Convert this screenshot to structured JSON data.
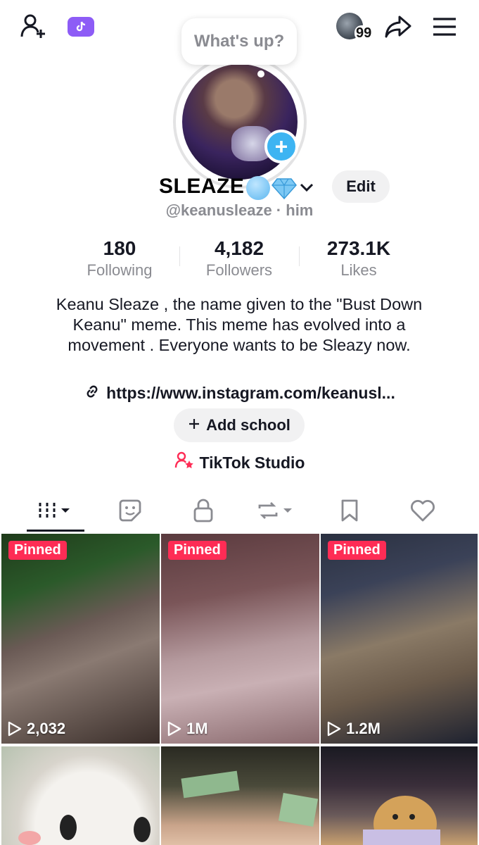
{
  "topbar": {
    "friend_count": "99",
    "icons": [
      "add-user-icon",
      "tiktok-icon",
      "share-icon",
      "menu-icon"
    ]
  },
  "status_bubble": {
    "text": "What's up?"
  },
  "profile": {
    "display_name": "SLEAZE",
    "handle": "@keanusleaze · him",
    "edit_label": "Edit",
    "stats": [
      {
        "value": "180",
        "label": "Following"
      },
      {
        "value": "4,182",
        "label": "Followers"
      },
      {
        "value": "273.1K",
        "label": "Likes"
      }
    ],
    "bio": "Keanu Sleaze , the name given to the \"Bust Down Keanu\" meme. This meme has evolved into a movement . Everyone wants to be Sleazy now.",
    "link": "https://www.instagram.com/keanusl...",
    "add_school_label": "Add school",
    "studio_label": "TikTok Studio"
  },
  "tabs": [
    "videos-grid-icon",
    "favorites-sticker-icon",
    "private-lock-icon",
    "reposts-icon",
    "bookmark-icon",
    "liked-heart-icon"
  ],
  "videos": [
    {
      "pinned_label": "Pinned",
      "views": "2,032"
    },
    {
      "pinned_label": "Pinned",
      "views": "1M"
    },
    {
      "pinned_label": "Pinned",
      "views": "1.2M"
    },
    {
      "pinned_label": "",
      "views": ""
    },
    {
      "pinned_label": "",
      "views": ""
    },
    {
      "pinned_label": "",
      "views": ""
    }
  ],
  "colors": {
    "accent_red": "#fe2c55",
    "plus_blue": "#3db4f2",
    "tiktok_purple": "#8d5cf6"
  }
}
